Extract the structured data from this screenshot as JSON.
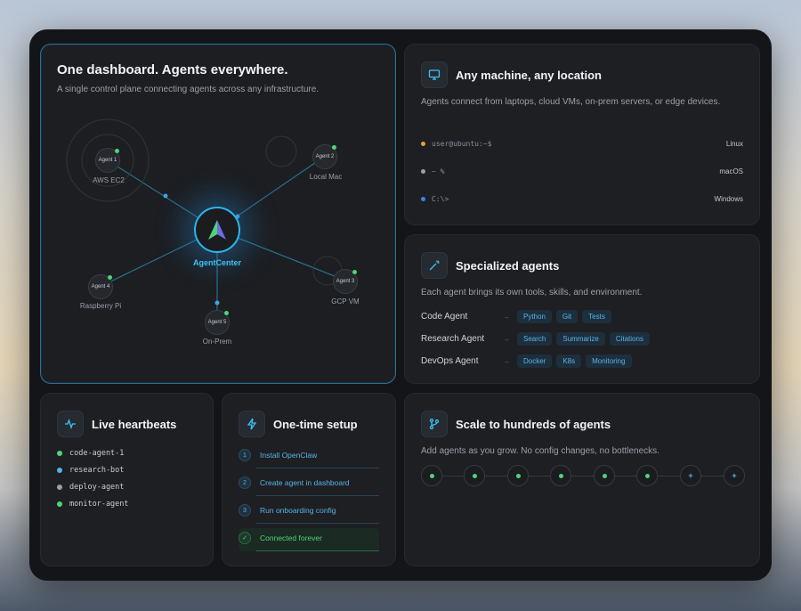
{
  "hero": {
    "title": "One dashboard. Agents everywhere.",
    "subtitle": "A single control plane connecting agents across any infrastructure.",
    "center_label": "AgentCenter",
    "nodes": [
      {
        "badge": "Agent 1",
        "label": "AWS EC2"
      },
      {
        "badge": "Agent 2",
        "label": "Local Mac"
      },
      {
        "badge": "Agent 3",
        "label": "GCP VM"
      },
      {
        "badge": "Agent 4",
        "label": "Raspberry Pi"
      },
      {
        "badge": "Agent 5",
        "label": "On-Prem"
      }
    ]
  },
  "machine": {
    "title": "Any machine, any location",
    "description": "Agents connect from laptops, cloud VMs, on-prem servers, or edge devices.",
    "terminals": [
      {
        "prompt": "user@ubuntu:~$",
        "os": "Linux",
        "dot_color": "#e8a13a"
      },
      {
        "prompt": "~ %",
        "os": "macOS",
        "dot_color": "#9aa0a8"
      },
      {
        "prompt": "C:\\>",
        "os": "Windows",
        "dot_color": "#3b82f6"
      }
    ]
  },
  "specialized": {
    "title": "Specialized agents",
    "description": "Each agent brings its own tools, skills, and environment.",
    "agents": [
      {
        "name": "Code Agent",
        "tags": [
          "Python",
          "Git",
          "Tests"
        ]
      },
      {
        "name": "Research Agent",
        "tags": [
          "Search",
          "Summarize",
          "Citations"
        ]
      },
      {
        "name": "DevOps Agent",
        "tags": [
          "Docker",
          "K8s",
          "Monitoring"
        ]
      }
    ]
  },
  "heartbeats": {
    "title": "Live heartbeats",
    "items": [
      {
        "name": "code-agent-1",
        "color": "#4fd37a"
      },
      {
        "name": "research-bot",
        "color": "#4fb6ea"
      },
      {
        "name": "deploy-agent",
        "color": "#9aa0a8"
      },
      {
        "name": "monitor-agent",
        "color": "#4fd37a"
      }
    ]
  },
  "setup": {
    "title": "One-time setup",
    "steps": [
      {
        "num": "1",
        "label": "Install OpenClaw"
      },
      {
        "num": "2",
        "label": "Create agent in dashboard"
      },
      {
        "num": "3",
        "label": "Run onboarding config"
      },
      {
        "num": "✓",
        "label": "Connected forever"
      }
    ]
  },
  "scale": {
    "title": "Scale to hundreds of agents",
    "description": "Add agents as you grow. No config changes, no bottlenecks.",
    "plus_symbol": "+"
  },
  "colors": {
    "accent": "#2bb6ee",
    "online": "#4fd37a"
  }
}
